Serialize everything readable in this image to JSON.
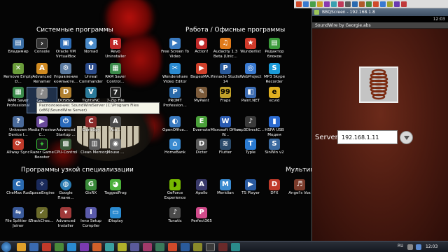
{
  "desktop": {
    "categories": {
      "system": "Системные программы",
      "office": "Работа / Офисные программы",
      "narrow": "Программы узкой специализации",
      "multimedia": "Мультиме"
    },
    "tooltip": "Расположение: SoundWireServer (C:\\Program Files (x86)\\SoundWire Server)",
    "icons": {
      "i1": "Владимир",
      "i2": "Console",
      "i3": "Oracle VM VirtualBox",
      "i4": "Nomad",
      "i5": "Revo Uninstaller",
      "i6": "Remove Empty D...",
      "i7": "Advanced Renamer",
      "i8": "Управление компьюте...",
      "i9": "Unreal Commander",
      "i10": "RAM Saver Control...",
      "i11": "RAM Saver Professional",
      "i12": "Sou...",
      "i13": "DOSBox",
      "i14": "TightVNC",
      "i15": "7-Zip File",
      "i16": "Unknown Device I...",
      "i17": "Media Preview C...",
      "i18": "Advanced Startup ...",
      "i19": "CloneSpy",
      "i20": "Ace...",
      "i21": "Allway Sync",
      "i22": "Razer Game Booster",
      "i23": "CPU-Control",
      "i24": "Clean Memory",
      "i25": "Mouse ...",
      "o1": "Free Screen To Video",
      "o2": "Action!",
      "o3": "Audacity 1.3 Beta (Unic...",
      "o4": "Wunderlist",
      "o5": "Редактор блоков",
      "o6": "Wondershare Video Editor",
      "o7": "ВидеоМА...",
      "o8": "Pinnacle Studio 14",
      "o9": "WebProject",
      "o10": "MP3 Skype Recorder",
      "o11": "PROMT Profession...",
      "o12": "MyPaint",
      "o13": "Fraps",
      "o14": "Paint.NET",
      "o15": "ecvid",
      "o16": "OpenOffice...",
      "o17": "Evernote",
      "o18": "Microsoft Office W...",
      "o19": "mp3DirectC...",
      "o20": "HSPA USB Модем",
      "o21": "HomeBank",
      "o22": "Dicter",
      "o23": "Flutter",
      "o24": "Typle",
      "o25": "SinWin v2",
      "n1": "CheMax Rus",
      "n2": "SpaceEngine",
      "n3": "Google Плане...",
      "n4": "GisRX",
      "n5": "TaggedFrog",
      "n6": "File Splitter & Joiner",
      "n7": "TrackChec...",
      "n8": "Advanced Installer",
      "n9": "Inno Setup Compiler",
      "n10": "iDisplay",
      "m1": "GeForce Experience",
      "m2": "Apollo",
      "m3": "Meridian",
      "m4": "TS Player",
      "m5": "DFX",
      "m6": "Angel's Vox",
      "m7": "Tunatic",
      "m8": "Perfect365"
    }
  },
  "emulator": {
    "window_title": "BBQScreen - 192.168.1.8",
    "status_time": "12:03",
    "app_title": "SoundWire by Georgie.abs",
    "server_label": "Server:",
    "server_value": "192.168.1.11"
  },
  "taskbar": {
    "lang": "RU",
    "clock": "12:03"
  }
}
